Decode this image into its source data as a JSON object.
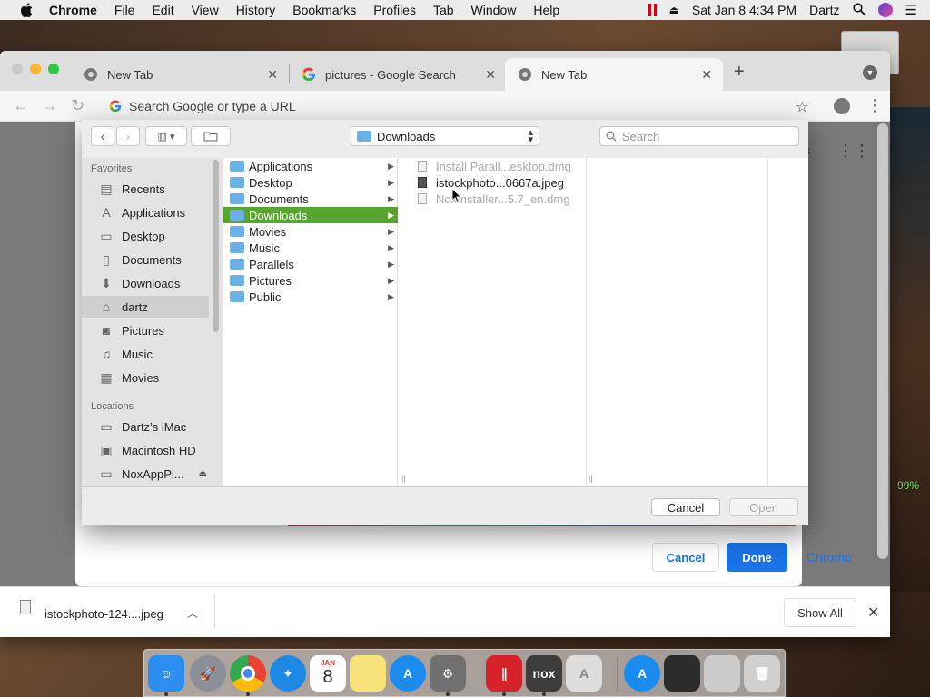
{
  "menubar": {
    "app_name": "Chrome",
    "items": [
      "File",
      "Edit",
      "View",
      "History",
      "Bookmarks",
      "Profiles",
      "Tab",
      "Window",
      "Help"
    ],
    "date_time": "Sat Jan 8  4:34 PM",
    "user": "Dartz"
  },
  "browser": {
    "tabs": [
      {
        "title": "New Tab"
      },
      {
        "title": "pictures - Google Search"
      },
      {
        "title": "New Tab"
      }
    ],
    "omnibox_placeholder": "Search Google or type a URL"
  },
  "file_dialog": {
    "location": "Downloads",
    "search_placeholder": "Search",
    "sidebar": {
      "favorites_header": "Favorites",
      "favorites": [
        {
          "label": "Recents",
          "icon": "clock-icon"
        },
        {
          "label": "Applications",
          "icon": "applications-icon"
        },
        {
          "label": "Desktop",
          "icon": "desktop-icon"
        },
        {
          "label": "Documents",
          "icon": "document-icon"
        },
        {
          "label": "Downloads",
          "icon": "download-icon"
        },
        {
          "label": "dartz",
          "icon": "home-icon"
        },
        {
          "label": "Pictures",
          "icon": "camera-icon"
        },
        {
          "label": "Music",
          "icon": "music-icon"
        },
        {
          "label": "Movies",
          "icon": "film-icon"
        }
      ],
      "locations_header": "Locations",
      "locations": [
        {
          "label": "Dartz’s iMac",
          "icon": "computer-icon"
        },
        {
          "label": "Macintosh HD",
          "icon": "hard-drive-icon"
        },
        {
          "label": "NoxAppPl...",
          "icon": "disk-icon"
        }
      ]
    },
    "folders": [
      "Applications",
      "Desktop",
      "Documents",
      "Downloads",
      "Movies",
      "Music",
      "Parallels",
      "Pictures",
      "Public"
    ],
    "selected_folder": "Downloads",
    "files": [
      {
        "name": "Install Parall...esktop.dmg",
        "enabled": false
      },
      {
        "name": "istockphoto...0667a.jpeg",
        "enabled": true
      },
      {
        "name": "NoxInstaller...5.7_en.dmg",
        "enabled": false
      }
    ],
    "cancel_label": "Cancel",
    "open_label": "Open"
  },
  "image_dialog": {
    "cancel_label": "Cancel",
    "done_label": "Done"
  },
  "behind": {
    "chip_text": "Chrome",
    "percent": "99%"
  },
  "downloads_bar": {
    "file_name": "istockphoto-124....jpeg",
    "show_all_label": "Show All"
  },
  "dock": {
    "calendar_month": "JAN",
    "calendar_day": "8",
    "apps": [
      {
        "name": "finder-icon",
        "color": "#2b8ef0"
      },
      {
        "name": "launchpad-icon",
        "color": "#8a8f99"
      },
      {
        "name": "chrome-icon",
        "color": "#e8e8e8"
      },
      {
        "name": "safari-icon",
        "color": "#1e88e5"
      },
      {
        "name": "calendar-icon",
        "color": "#ffffff"
      },
      {
        "name": "notes-icon",
        "color": "#f7e27a"
      },
      {
        "name": "app-store-icon",
        "color": "#1a8cf0"
      },
      {
        "name": "system-preferences-icon",
        "color": "#707070"
      },
      {
        "name": "parallels-icon",
        "color": "#d8222a"
      },
      {
        "name": "nox-icon",
        "color": "#3c3c3c"
      },
      {
        "name": "instruments-icon",
        "color": "#dddddd"
      },
      {
        "name": "app-store-folder-icon",
        "color": "#1a8cf0"
      },
      {
        "name": "photo-icon",
        "color": "#2c2c2c"
      },
      {
        "name": "preview-icon",
        "color": "#cccccc"
      },
      {
        "name": "trash-icon",
        "color": "#d0d0d0"
      }
    ]
  }
}
